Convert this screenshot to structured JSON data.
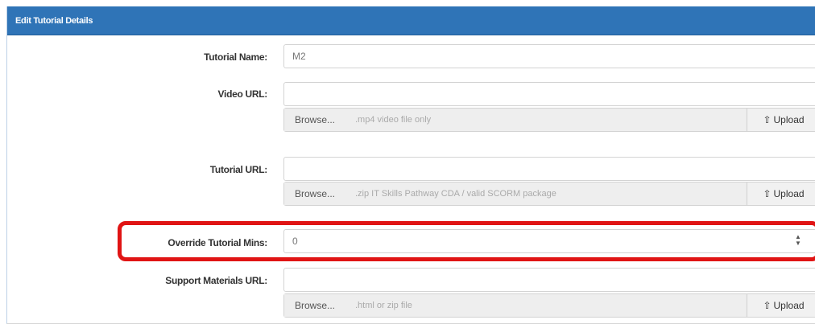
{
  "panel": {
    "title": "Edit Tutorial Details"
  },
  "form": {
    "tutorial_name": {
      "label": "Tutorial Name:",
      "value": "M2"
    },
    "video_url": {
      "label": "Video URL:",
      "value": "",
      "browse_label": "Browse...",
      "file_placeholder": ".mp4 video file only",
      "upload_label": "Upload"
    },
    "tutorial_url": {
      "label": "Tutorial URL:",
      "value": "",
      "browse_label": "Browse...",
      "file_placeholder": ".zip IT Skills Pathway CDA / valid SCORM package",
      "upload_label": "Upload"
    },
    "override_mins": {
      "label": "Override Tutorial Mins:",
      "value": "0"
    },
    "support_url": {
      "label": "Support Materials URL:",
      "value": "",
      "browse_label": "Browse...",
      "file_placeholder": ".html or zip file",
      "upload_label": "Upload"
    }
  },
  "icons": {
    "upload": "upload-icon",
    "spinner": "spinner-arrows-icon"
  },
  "colors": {
    "header": "#2f74b7",
    "highlight": "#e01414"
  }
}
